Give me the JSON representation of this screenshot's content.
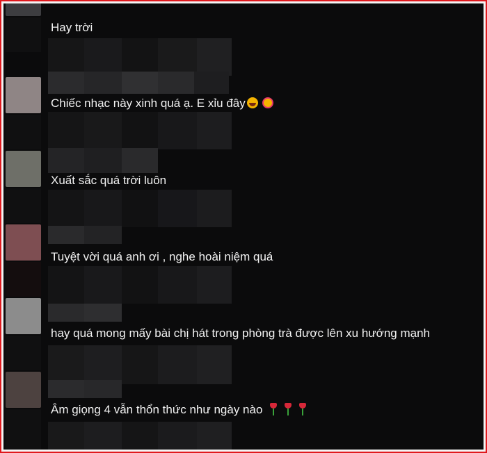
{
  "comments": [
    {
      "text": "Hay trời",
      "avatar_color": "#3d3d40",
      "emojis": []
    },
    {
      "text": "Chiếc nhạc này xinh quá ạ. E xỉu đây",
      "avatar_color": "#8f8585",
      "emojis": [
        "laughing-face-icon",
        "smiling-face-with-hearts-icon"
      ]
    },
    {
      "text": "Xuất sắc quá trời luôn",
      "avatar_color": "#6e6f68",
      "emojis": []
    },
    {
      "text": "Tuyệt vời quá anh ơi , nghe hoài niệm quá",
      "avatar_color": "#7e4e52",
      "emojis": []
    },
    {
      "text": "hay quá mong mấy bài chị hát trong phòng trà được lên xu hướng mạnh",
      "avatar_color": "#8c8c8c",
      "emojis": []
    },
    {
      "text": "Âm giọng 4 vẫn thổn thức như ngày nào",
      "avatar_color": "#4d4240",
      "emojis": [
        "tulip-icon",
        "tulip-icon",
        "tulip-icon"
      ]
    }
  ],
  "colors": {
    "frame_border": "#e0191e",
    "background": "#0b0b0c",
    "text": "#f2f2f2"
  }
}
